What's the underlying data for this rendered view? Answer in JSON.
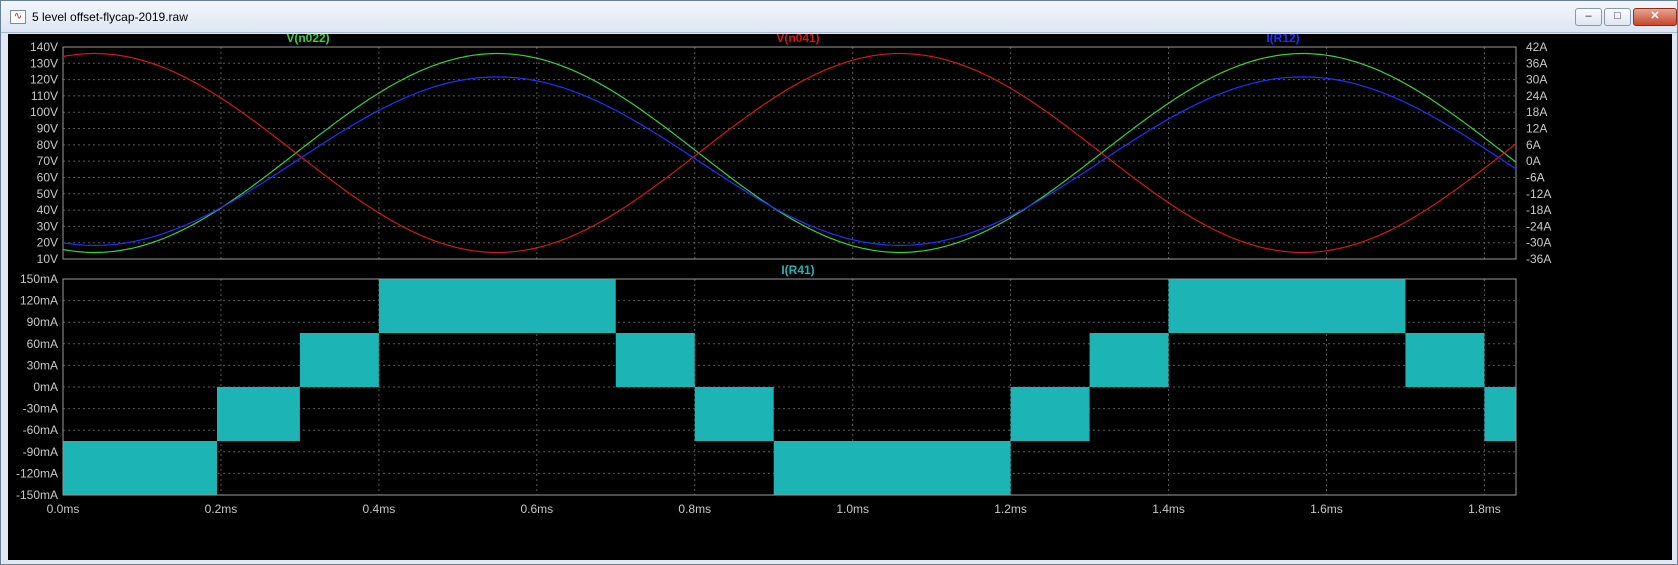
{
  "window": {
    "title": "5 level offset-flycap-2019.raw",
    "app_icon": "waveform-icon",
    "buttons": {
      "minimize": "–",
      "maximize": "□",
      "close": "✕"
    }
  },
  "colors": {
    "background": "#000000",
    "axis_text": "#c8c8c8",
    "grid": "#5a5a5a",
    "v_n022": "#35d335",
    "v_n041": "#d01818",
    "i_r12": "#2030ff",
    "i_r41": "#1cb4b4"
  },
  "chart_data": [
    {
      "type": "line",
      "x_axis": {
        "range_ms": [
          0,
          1.84
        ],
        "ticks": [
          0,
          0.2,
          0.4,
          0.6,
          0.8,
          1.0,
          1.2,
          1.4,
          1.6,
          1.8
        ],
        "tick_labels": [
          "0.0ms",
          "0.2ms",
          "0.4ms",
          "0.6ms",
          "0.8ms",
          "1.0ms",
          "1.2ms",
          "1.4ms",
          "1.6ms",
          "1.8ms"
        ]
      },
      "left_axis": {
        "range": [
          10,
          140
        ],
        "ticks": [
          10,
          20,
          30,
          40,
          50,
          60,
          70,
          80,
          90,
          100,
          110,
          120,
          130,
          140
        ],
        "tick_labels": [
          "10V",
          "20V",
          "30V",
          "40V",
          "50V",
          "60V",
          "70V",
          "80V",
          "90V",
          "100V",
          "110V",
          "120V",
          "130V",
          "140V"
        ]
      },
      "right_axis": {
        "range": [
          -36,
          42
        ],
        "ticks": [
          -36,
          -30,
          -24,
          -18,
          -12,
          -6,
          0,
          6,
          12,
          18,
          24,
          30,
          36,
          42
        ],
        "tick_labels": [
          "-36A",
          "-30A",
          "-24A",
          "-18A",
          "-12A",
          "-6A",
          "0A",
          "6A",
          "12A",
          "18A",
          "24A",
          "30A",
          "36A",
          "42A"
        ]
      },
      "grid": true,
      "series": [
        {
          "name": "V(n022)",
          "axis": "left",
          "color_key": "v_n022",
          "amplitude": 61,
          "offset": 75,
          "peak_ms": 0.55,
          "period_ms": 1.02
        },
        {
          "name": "V(n041)",
          "axis": "left",
          "color_key": "v_n041",
          "amplitude": 61,
          "offset": 75,
          "peak_ms": 0.04,
          "period_ms": 1.02
        },
        {
          "name": "I(R12)",
          "axis": "right",
          "color_key": "i_r12",
          "amplitude": 31,
          "offset": 0,
          "peak_ms": 0.55,
          "period_ms": 1.02
        }
      ]
    },
    {
      "type": "area",
      "x_axis": {
        "range_ms": [
          0,
          1.84
        ],
        "ticks": [
          0,
          0.2,
          0.4,
          0.6,
          0.8,
          1.0,
          1.2,
          1.4,
          1.6,
          1.8
        ],
        "tick_labels": [
          "0.0ms",
          "0.2ms",
          "0.4ms",
          "0.6ms",
          "0.8ms",
          "1.0ms",
          "1.2ms",
          "1.4ms",
          "1.6ms",
          "1.8ms"
        ]
      },
      "left_axis": {
        "range": [
          -150,
          150
        ],
        "ticks": [
          -150,
          -120,
          -90,
          -60,
          -30,
          0,
          30,
          60,
          90,
          120,
          150
        ],
        "tick_labels": [
          "-150mA",
          "-120mA",
          "-90mA",
          "-60mA",
          "-30mA",
          "0mA",
          "30mA",
          "60mA",
          "90mA",
          "120mA",
          "150mA"
        ]
      },
      "grid": true,
      "series": [
        {
          "name": "I(R41)",
          "color_key": "i_r41",
          "bands": [
            {
              "t0": 0.0,
              "t1": 0.195,
              "lo": -150,
              "hi": -75
            },
            {
              "t0": 0.195,
              "t1": 0.3,
              "lo": -75,
              "hi": 0
            },
            {
              "t0": 0.3,
              "t1": 0.4,
              "lo": 0,
              "hi": 75
            },
            {
              "t0": 0.4,
              "t1": 0.7,
              "lo": 75,
              "hi": 150
            },
            {
              "t0": 0.7,
              "t1": 0.8,
              "lo": 0,
              "hi": 75
            },
            {
              "t0": 0.8,
              "t1": 0.9,
              "lo": -75,
              "hi": 0
            },
            {
              "t0": 0.9,
              "t1": 1.2,
              "lo": -150,
              "hi": -75
            },
            {
              "t0": 1.2,
              "t1": 1.3,
              "lo": -75,
              "hi": 0
            },
            {
              "t0": 1.3,
              "t1": 1.4,
              "lo": 0,
              "hi": 75
            },
            {
              "t0": 1.4,
              "t1": 1.7,
              "lo": 75,
              "hi": 150
            },
            {
              "t0": 1.7,
              "t1": 1.8,
              "lo": 0,
              "hi": 75
            },
            {
              "t0": 1.8,
              "t1": 1.84,
              "lo": -75,
              "hi": 0
            }
          ]
        }
      ]
    }
  ]
}
